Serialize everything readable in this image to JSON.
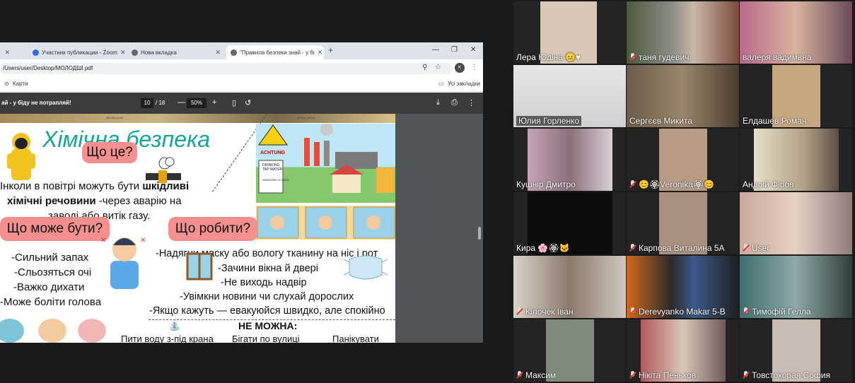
{
  "browser": {
    "tabs": [
      {
        "label": "Участник публикации - Zoom",
        "icon": "zoom-icon"
      },
      {
        "label": "Нова вкладка",
        "icon": "chrome-icon"
      },
      {
        "label": "\"Правила безпеки знай - у бі",
        "icon": "chrome-icon"
      }
    ],
    "url": "/Users/user/Desktop/МОЛОДШІ.pdf",
    "bookmark": "Карти",
    "all_bookmarks": "Усі закладки",
    "profile_initial": "K"
  },
  "pdf": {
    "doc_title": "ай - у біду не потрапляй!",
    "page_current": "10",
    "page_total": "/ 18",
    "zoom": "50%",
    "credit_left": "@Kelterscalt/",
    "credit_right": "@King_bashin"
  },
  "slide": {
    "title": "Хімічна безпека",
    "what_is": "Що це?",
    "desc_line1_pre": "Інколи в повітрі можуть бути ",
    "desc_line1_bold": "шкідливі",
    "desc_line2_bold": "хімічні речовини",
    "desc_line2_post": " -через аварію на",
    "desc_line3": "заводі або витік газу.",
    "what_can": "Що може бути?",
    "symptoms": [
      "-Сильний запах",
      "-Сльозяться очі",
      "-Важко дихати",
      "-Може боліти голова"
    ],
    "what_do": "Що робити?",
    "actions": [
      "-Надягни маску або вологу тканину на ніс і рот",
      "-Зачини вікна й двері",
      "-Не виходь надвір",
      "-Увімкни новини чи слухай дорослих",
      "-Якщо кажуть — евакуюйся швидко, але спокійно"
    ],
    "cannot": "НЕ МОЖНА:",
    "cannot_items": [
      "Пити воду з-під крана",
      "Бігати по вулиці",
      "Панікувати"
    ],
    "sign_text": "ACHTUNG",
    "poster_line1": "DRINKING",
    "poster_line2": "TAP WATER",
    "poster_line3": "WINDOWS CLOSED"
  },
  "participants": [
    {
      "name": "Лера Юдіна 😐♥",
      "muted": false
    },
    {
      "name": "таня гудевич",
      "muted": true
    },
    {
      "name": "валеря вадимвна",
      "muted": false
    },
    {
      "name": "Юлия Горленко",
      "muted": false,
      "active": true
    },
    {
      "name": "Сергєєв Микита",
      "muted": false
    },
    {
      "name": "Елдашев Роман",
      "muted": false
    },
    {
      "name": "Кушнір Дмитро",
      "muted": false
    },
    {
      "name": "😊🏵Veronika🏵😊",
      "muted": true
    },
    {
      "name": "Андрій Фіров",
      "muted": false
    },
    {
      "name": "Кира 🌸🏵🐱",
      "muted": false
    },
    {
      "name": "Карпова Виталина 5А",
      "muted": true
    },
    {
      "name": "User",
      "muted": true
    },
    {
      "name": "Кілочек Іван",
      "muted": true
    },
    {
      "name": "Derevyanko Makar 5-B",
      "muted": true
    },
    {
      "name": "Тимофій Гелла",
      "muted": true
    },
    {
      "name": "Максим",
      "muted": true
    },
    {
      "name": "Нікіта Пеньков",
      "muted": true
    },
    {
      "name": "Товстокорая София",
      "muted": true
    }
  ]
}
